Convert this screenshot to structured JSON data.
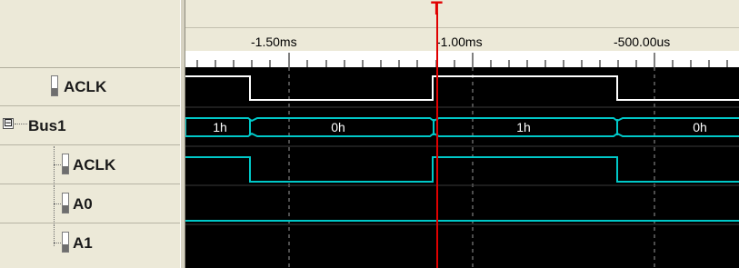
{
  "cursor": {
    "label": "T"
  },
  "timeline": {
    "labels": [
      "-1.50ms",
      "-1.00ms",
      "-500.00us"
    ]
  },
  "signals": [
    {
      "label": "ACLK"
    },
    {
      "label": "Bus1",
      "expand_symbol": "⊟"
    },
    {
      "label": "ACLK"
    },
    {
      "label": "A0"
    },
    {
      "label": "A1"
    }
  ],
  "bus_values": [
    "1h",
    "0h",
    "1h",
    "0h"
  ],
  "colors": {
    "waveform_background": "#000000",
    "clock_trace": "#ffffff",
    "bus_trace": "#00c8c8",
    "cursor": "#e00000",
    "grid": "#9a9a9a"
  }
}
